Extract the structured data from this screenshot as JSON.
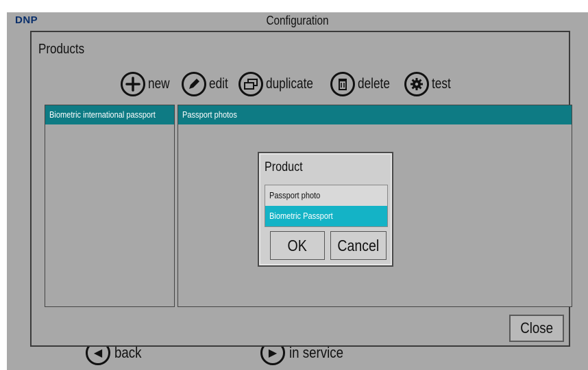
{
  "app": {
    "logo": "DNP",
    "title": "Configuration"
  },
  "bottom_nav": {
    "back_label": "back",
    "in_service_label": "in service"
  },
  "products": {
    "title": "Products",
    "toolbar": {
      "new_label": "new",
      "edit_label": "edit",
      "duplicate_label": "duplicate",
      "delete_label": "delete",
      "test_label": "test"
    },
    "left_list": [
      "Biometric international passport"
    ],
    "right_list": [
      "Passport photos"
    ],
    "close_label": "Close"
  },
  "product_dialog": {
    "title": "Product",
    "options": [
      "Passport photo",
      "Biometric Passport"
    ],
    "selected_option": "Biometric Passport",
    "ok_label": "OK",
    "cancel_label": "Cancel"
  },
  "colors": {
    "background": "#a8a8a8",
    "list_selected": "#0e7b84",
    "option_selected": "#14b3c6"
  }
}
